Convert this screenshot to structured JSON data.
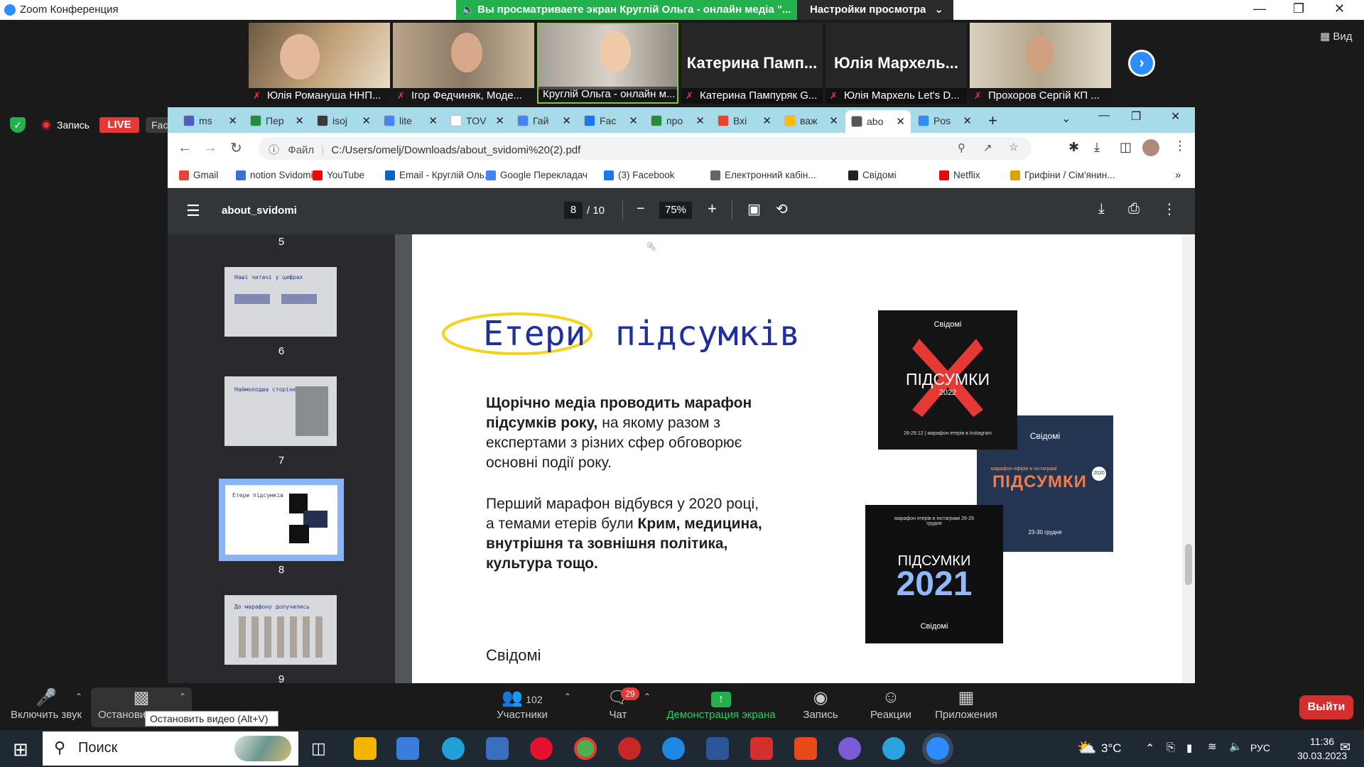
{
  "zoom": {
    "title": "Zoom Конференция",
    "share_banner": "Вы просматриваете экран Круглій Ольга - онлайн медіа \"...",
    "view_settings": "Настройки просмотра",
    "view_label": "Вид",
    "participants": [
      {
        "name": "Юлія Романуша ННП...",
        "type": "video",
        "bg": "#8c7a62"
      },
      {
        "name": "Ігор Федчиняк, Моде...",
        "type": "video",
        "bg": "#9c8d79"
      },
      {
        "name": "Круглій Ольга - онлайн м...",
        "type": "video",
        "bg": "#7f7a6f"
      },
      {
        "name": "Катерина Пампуряк G...",
        "type": "name",
        "big": "Катерина Памп..."
      },
      {
        "name": "Юлія Мархель Let's D...",
        "type": "name",
        "big": "Юлія Мархель..."
      },
      {
        "name": "Прохоров Сергій КП ...",
        "type": "video",
        "bg": "#b8ad98"
      }
    ],
    "record_label": "Запись",
    "live_label": "LIVE",
    "facebook_label": "Facebook",
    "toolbar": {
      "mute": "Включить звук",
      "video": "Остановить видео",
      "participants": "Участники",
      "participants_count": "102",
      "chat": "Чат",
      "chat_badge": "29",
      "share": "Демонстрация экрана",
      "record": "Запись",
      "reactions": "Реакции",
      "apps": "Приложения",
      "leave": "Выйти"
    },
    "tooltip": "Остановить видео (Alt+V)"
  },
  "chrome": {
    "tabs": [
      {
        "label": "ms",
        "color": "#4a5fc1"
      },
      {
        "label": "Пер",
        "color": "#1e8e3e"
      },
      {
        "label": "isoj",
        "color": "#3a3a3a"
      },
      {
        "label": "lite",
        "color": "#4285f4"
      },
      {
        "label": "TOV",
        "color": "#ffffff"
      },
      {
        "label": "Гай",
        "color": "#4285f4"
      },
      {
        "label": "Fac",
        "color": "#1877f2"
      },
      {
        "label": "про",
        "color": "#1e8e3e"
      },
      {
        "label": "Вхі",
        "color": "#ea4335"
      },
      {
        "label": "важ",
        "color": "#fbbc04"
      },
      {
        "label": "abo",
        "color": "#555555"
      },
      {
        "label": "Pos",
        "color": "#2d8cff"
      }
    ],
    "address_prefix": "Файл",
    "address": "C:/Users/omelj/Downloads/about_svidomi%20(2).pdf",
    "bookmarks": [
      {
        "label": "Gmail",
        "color": "#ea4335"
      },
      {
        "label": "notion Svidomi",
        "color": "#3c6fd8"
      },
      {
        "label": "YouTube",
        "color": "#ff0000"
      },
      {
        "label": "Email - Круглій Оль...",
        "color": "#0a64c2"
      },
      {
        "label": "Google Перекладач",
        "color": "#4285f4"
      },
      {
        "label": "(3) Facebook",
        "color": "#1877f2"
      },
      {
        "label": "Електронний кабін...",
        "color": "#666666"
      },
      {
        "label": "Свідомі",
        "color": "#222222"
      },
      {
        "label": "Netflix",
        "color": "#e50914"
      },
      {
        "label": "Грифіни / Сім'янин...",
        "color": "#d9a400"
      }
    ],
    "more_bookmarks": "»"
  },
  "pdf": {
    "filename": "about_svidomi",
    "page_current": "8",
    "page_total": "/ 10",
    "zoom": "75%",
    "thumbnails": [
      {
        "num": "5",
        "title": ""
      },
      {
        "num": "6",
        "title": "Наші читачі у цифрах"
      },
      {
        "num": "7",
        "title": "Наймолодша сторінка"
      },
      {
        "num": "8",
        "title": "Етери підсумків",
        "active": true
      },
      {
        "num": "9",
        "title": "До марафону долучились"
      }
    ],
    "slide": {
      "title_word1": "Етери",
      "title_word2": "підсумків",
      "para1_bold": "Щорічно медіа проводить марафон підсумків року,",
      "para1_rest": " на якому разом з експертами з різних сфер обговорює основні події року.",
      "para2_start": "Перший марафон відбувся у 2020 році, а темами етерів були ",
      "para2_bold": "Крим, медицина, внутрішня та зовнішня політика, культура тощо.",
      "footer": "Свідомі",
      "poster_brand": "Свідомі",
      "poster1_title": "ПІДСУМКИ",
      "poster1_year": "2022",
      "poster1_caption": "26-29.12  |  марафон етерів в Instagram",
      "poster2_caption": "марафон ефірів в інстаграмі",
      "poster2_title": "ПІДСУМКИ",
      "poster2_year": "2020",
      "poster2_dates": "23-30 грудня",
      "poster3_caption": "марафон етерів в інстаграмі 26-29 грудня",
      "poster3_title": "ПІДСУМКИ",
      "poster3_year": "2021"
    }
  },
  "taskbar": {
    "search": "Поиск",
    "weather": "3°C",
    "lang": "РУС",
    "time": "11:36",
    "date": "30.03.2023"
  }
}
